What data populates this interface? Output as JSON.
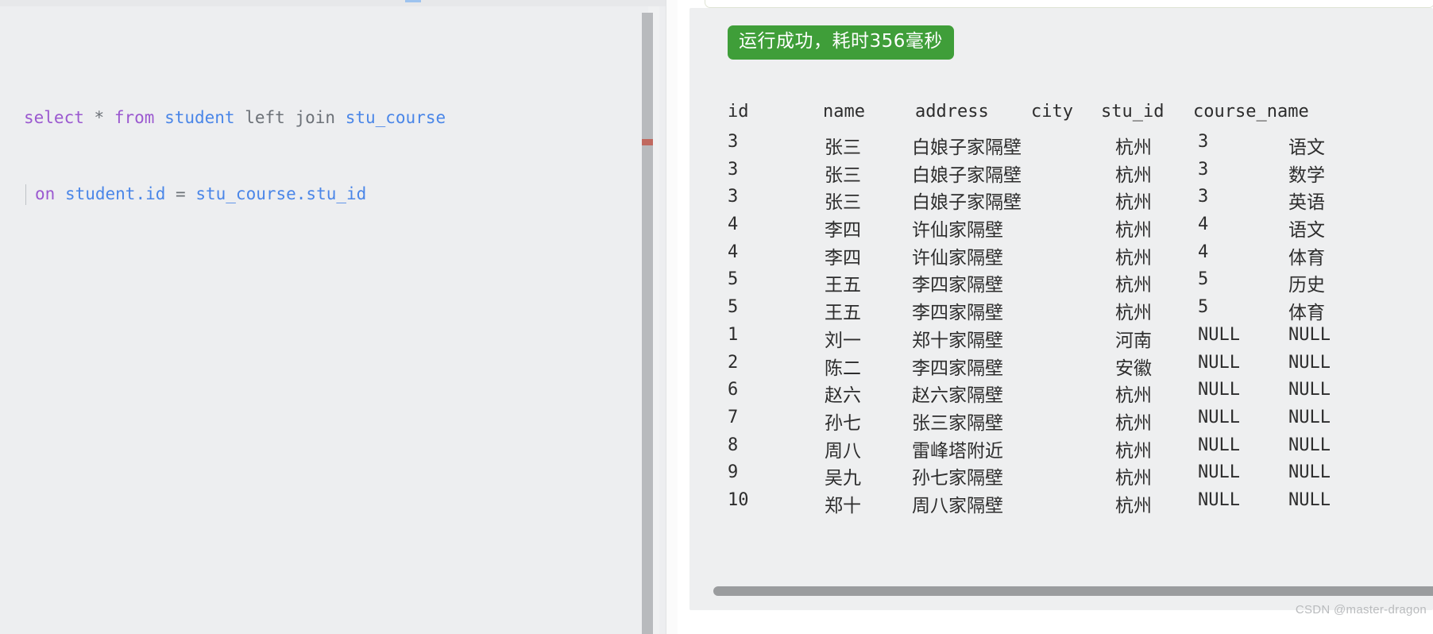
{
  "editor": {
    "language": "sql",
    "lines": [
      {
        "tokens": [
          {
            "text": "select",
            "kind": "kw"
          },
          {
            "text": " ",
            "kind": "plain"
          },
          {
            "text": "*",
            "kind": "op"
          },
          {
            "text": " ",
            "kind": "plain"
          },
          {
            "text": "from",
            "kind": "kw"
          },
          {
            "text": " ",
            "kind": "plain"
          },
          {
            "text": "student",
            "kind": "ident"
          },
          {
            "text": " ",
            "kind": "plain"
          },
          {
            "text": "left join",
            "kind": "plain"
          },
          {
            "text": " ",
            "kind": "plain"
          },
          {
            "text": "stu_course",
            "kind": "ident"
          }
        ]
      },
      {
        "tokens": [
          {
            "text": "on",
            "kind": "kw"
          },
          {
            "text": " ",
            "kind": "plain"
          },
          {
            "text": "student.id",
            "kind": "ident"
          },
          {
            "text": " ",
            "kind": "plain"
          },
          {
            "text": "=",
            "kind": "op"
          },
          {
            "text": " ",
            "kind": "plain"
          },
          {
            "text": "stu_course.stu_id",
            "kind": "ident"
          }
        ]
      }
    ],
    "line1_plain": "select * from student left join stu_course",
    "line2_plain": "on student.id = stu_course.stu_id"
  },
  "result": {
    "status_badge": "运行成功，耗时356毫秒",
    "status_color": "#3f9e39",
    "columns": [
      "id",
      "name",
      "address",
      "city",
      "stu_id",
      "course_name"
    ],
    "rows": [
      {
        "id": "3",
        "name": "张三",
        "address": "白娘子家隔壁",
        "city": "杭州",
        "stu_id": "3",
        "course_name": "语文"
      },
      {
        "id": "3",
        "name": "张三",
        "address": "白娘子家隔壁",
        "city": "杭州",
        "stu_id": "3",
        "course_name": "数学"
      },
      {
        "id": "3",
        "name": "张三",
        "address": "白娘子家隔壁",
        "city": "杭州",
        "stu_id": "3",
        "course_name": "英语"
      },
      {
        "id": "4",
        "name": "李四",
        "address": "许仙家隔壁",
        "city": "杭州",
        "stu_id": "4",
        "course_name": "语文"
      },
      {
        "id": "4",
        "name": "李四",
        "address": "许仙家隔壁",
        "city": "杭州",
        "stu_id": "4",
        "course_name": "体育"
      },
      {
        "id": "5",
        "name": "王五",
        "address": "李四家隔壁",
        "city": "杭州",
        "stu_id": "5",
        "course_name": "历史"
      },
      {
        "id": "5",
        "name": "王五",
        "address": "李四家隔壁",
        "city": "杭州",
        "stu_id": "5",
        "course_name": "体育"
      },
      {
        "id": "1",
        "name": "刘一",
        "address": "郑十家隔壁",
        "city": "河南",
        "stu_id": "NULL",
        "course_name": "NULL"
      },
      {
        "id": "2",
        "name": "陈二",
        "address": "李四家隔壁",
        "city": "安徽",
        "stu_id": "NULL",
        "course_name": "NULL"
      },
      {
        "id": "6",
        "name": "赵六",
        "address": "赵六家隔壁",
        "city": "杭州",
        "stu_id": "NULL",
        "course_name": "NULL"
      },
      {
        "id": "7",
        "name": "孙七",
        "address": "张三家隔壁",
        "city": "杭州",
        "stu_id": "NULL",
        "course_name": "NULL"
      },
      {
        "id": "8",
        "name": "周八",
        "address": "雷峰塔附近",
        "city": "杭州",
        "stu_id": "NULL",
        "course_name": "NULL"
      },
      {
        "id": "9",
        "name": "吴九",
        "address": "孙七家隔壁",
        "city": "杭州",
        "stu_id": "NULL",
        "course_name": "NULL"
      },
      {
        "id": "10",
        "name": "郑十",
        "address": "周八家隔壁",
        "city": "杭州",
        "stu_id": "NULL",
        "course_name": "NULL"
      }
    ]
  },
  "watermark": "CSDN @master-dragon"
}
